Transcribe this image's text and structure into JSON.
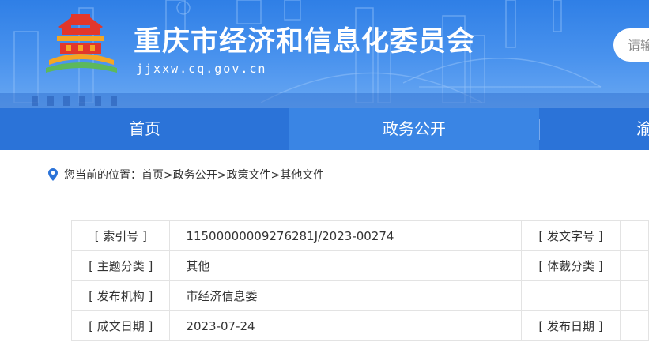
{
  "header": {
    "site_title": "重庆市经济和信息化委员会",
    "site_domain": "jjxxw.cq.gov.cn",
    "search_placeholder": "请输",
    "colors": {
      "banner": "#3d8be9",
      "nav": "#2b73d8",
      "nav_active": "#3a85e4",
      "logo_red": "#e2372b",
      "logo_orange": "#f5a623",
      "logo_green": "#5cb85c"
    }
  },
  "nav": {
    "items": [
      {
        "label": "首页"
      },
      {
        "label": "政务公开"
      },
      {
        "label": "渝"
      }
    ],
    "active_index": 1
  },
  "breadcrumb": {
    "prefix": "您当前的位置：",
    "items": [
      "首页",
      " >政务公开",
      " >政策文件",
      " >其他文件"
    ]
  },
  "info": {
    "rows": [
      {
        "label": "[ 索引号 ]",
        "value": "11500000009276281J/2023-00274",
        "label2": "[ 发文字号 ]",
        "value2": ""
      },
      {
        "label": "[ 主题分类 ]",
        "value": "其他",
        "label2": "[ 体裁分类 ]",
        "value2": ""
      },
      {
        "label": "[ 发布机构 ]",
        "value": "市经济信息委",
        "label2": "",
        "value2": ""
      },
      {
        "label": "[ 成文日期 ]",
        "value": "2023-07-24",
        "label2": "[ 发布日期 ]",
        "value2": ""
      }
    ]
  }
}
